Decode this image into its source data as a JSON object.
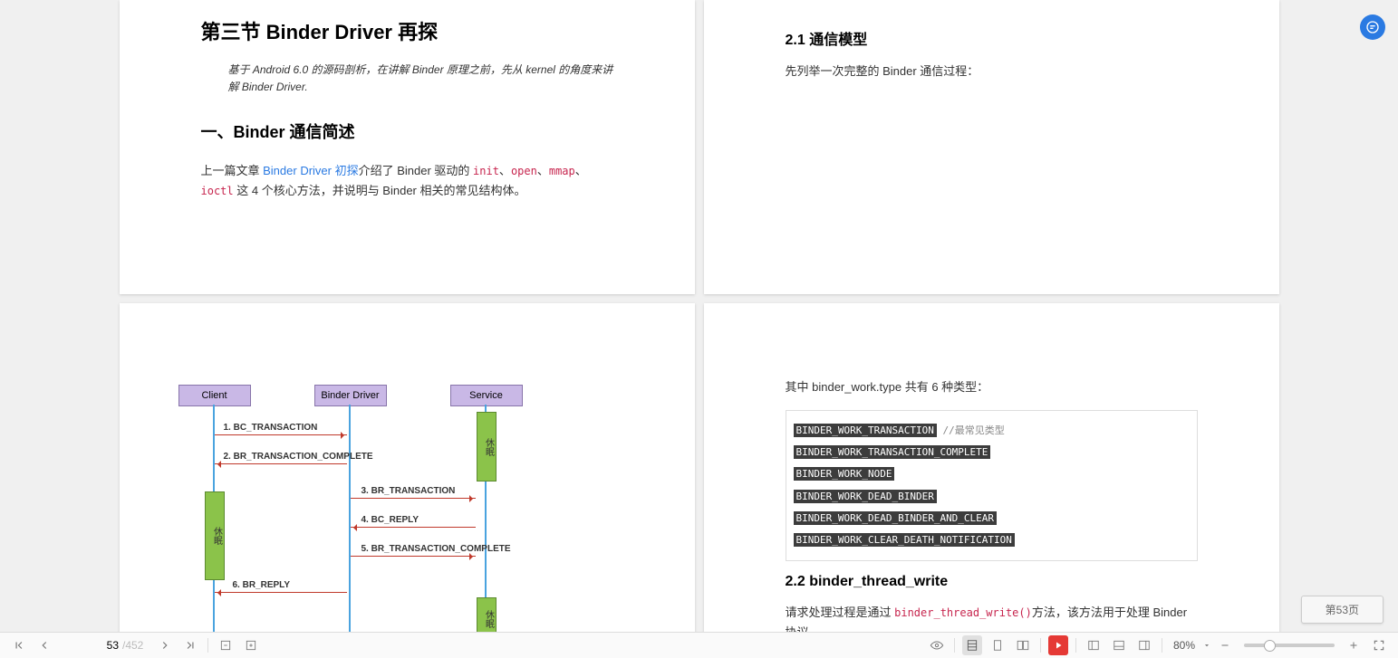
{
  "pages": {
    "topLeft": {
      "title": "第三节 Binder Driver 再探",
      "intro": "基于 Android 6.0 的源码剖析，在讲解 Binder 原理之前，先从 kernel 的角度来讲解 Binder Driver.",
      "sectionTitle": "一、Binder 通信简述",
      "para_prefix": "上一篇文章 ",
      "para_link": "Binder Driver 初探",
      "para_mid": "介绍了 Binder 驱动的 ",
      "code1": "init",
      "sep": "、",
      "code2": "open",
      "code3": "mmap",
      "code4": "ioctl",
      "para_suffix": " 这 4 个核心方法，并说明与 Binder 相关的常见结构体。"
    },
    "topRight": {
      "h3": "2.1  通信模型",
      "para": "先列举一次完整的 Binder 通信过程："
    },
    "bottomLeft": {
      "actors": {
        "client": "Client",
        "driver": "Binder Driver",
        "service": "Service"
      },
      "msgs": {
        "m1": "1. BC_TRANSACTION",
        "m2": "2. BR_TRANSACTION_COMPLETE",
        "m3": "3. BR_TRANSACTION",
        "m4": "4. BC_REPLY",
        "m5": "5. BR_TRANSACTION_COMPLETE",
        "m6": "6. BR_REPLY"
      },
      "sleep": "休眠"
    },
    "bottomRight": {
      "intro": "其中 binder_work.type 共有 6 种类型：",
      "codes": {
        "c1": "BINDER_WORK_TRANSACTION",
        "c1_comment": " //最常见类型",
        "c2": "BINDER_WORK_TRANSACTION_COMPLETE",
        "c3": "BINDER_WORK_NODE",
        "c4": "BINDER_WORK_DEAD_BINDER",
        "c5": "BINDER_WORK_DEAD_BINDER_AND_CLEAR",
        "c6": "BINDER_WORK_CLEAR_DEATH_NOTIFICATION"
      },
      "h3": "2.2 binder_thread_write",
      "p_prefix": "请求处理过程是通过 ",
      "p_code": "binder_thread_write()",
      "p_suffix": "方法，该方法用于处理 Binder 协议"
    }
  },
  "toolbar": {
    "pageCurrent": "53",
    "pageTotal": "/452",
    "zoom": "80%",
    "pageBadge": "第53页"
  }
}
